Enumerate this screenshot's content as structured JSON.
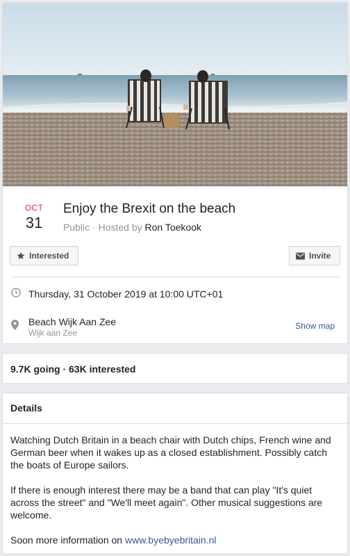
{
  "event": {
    "cover_image": "beach-chairs-photo",
    "date": {
      "month": "OCT",
      "day": "31"
    },
    "title": "Enjoy the Brexit on the beach",
    "privacy": "Public",
    "hosted_by_prefix": " · Hosted by ",
    "host": "Ron Toekook"
  },
  "actions": {
    "interested": {
      "label": "Interested",
      "icon": "star-icon"
    },
    "invite": {
      "label": "Invite",
      "icon": "envelope-icon"
    }
  },
  "info": {
    "datetime": {
      "icon": "clock-icon",
      "text": "Thursday, 31 October 2019 at 10:00 UTC+01"
    },
    "location": {
      "icon": "location-pin-icon",
      "name": "Beach Wijk Aan Zee",
      "sub": "Wijk aan Zee",
      "show_map": "Show map"
    }
  },
  "stats": {
    "text": "9.7K going · 63K interested"
  },
  "details": {
    "heading": "Details",
    "paragraph_1": "Watching Dutch Britain in a beach chair with Dutch chips, French wine and German beer when it wakes up as a closed establishment. Possibly catch the boats of Europe sailors.",
    "paragraph_2": "If there is enough interest there may be a band that can play \"It's quiet across the street\" and \"We'll meet again\". Other musical suggestions are welcome.",
    "more_info_prefix": "Soon more information on ",
    "link": "www.byebyebritain.nl"
  },
  "colors": {
    "date_month": "#e41e3f",
    "link": "#365899",
    "muted": "#90949c",
    "page_bg": "#e9ebee"
  }
}
